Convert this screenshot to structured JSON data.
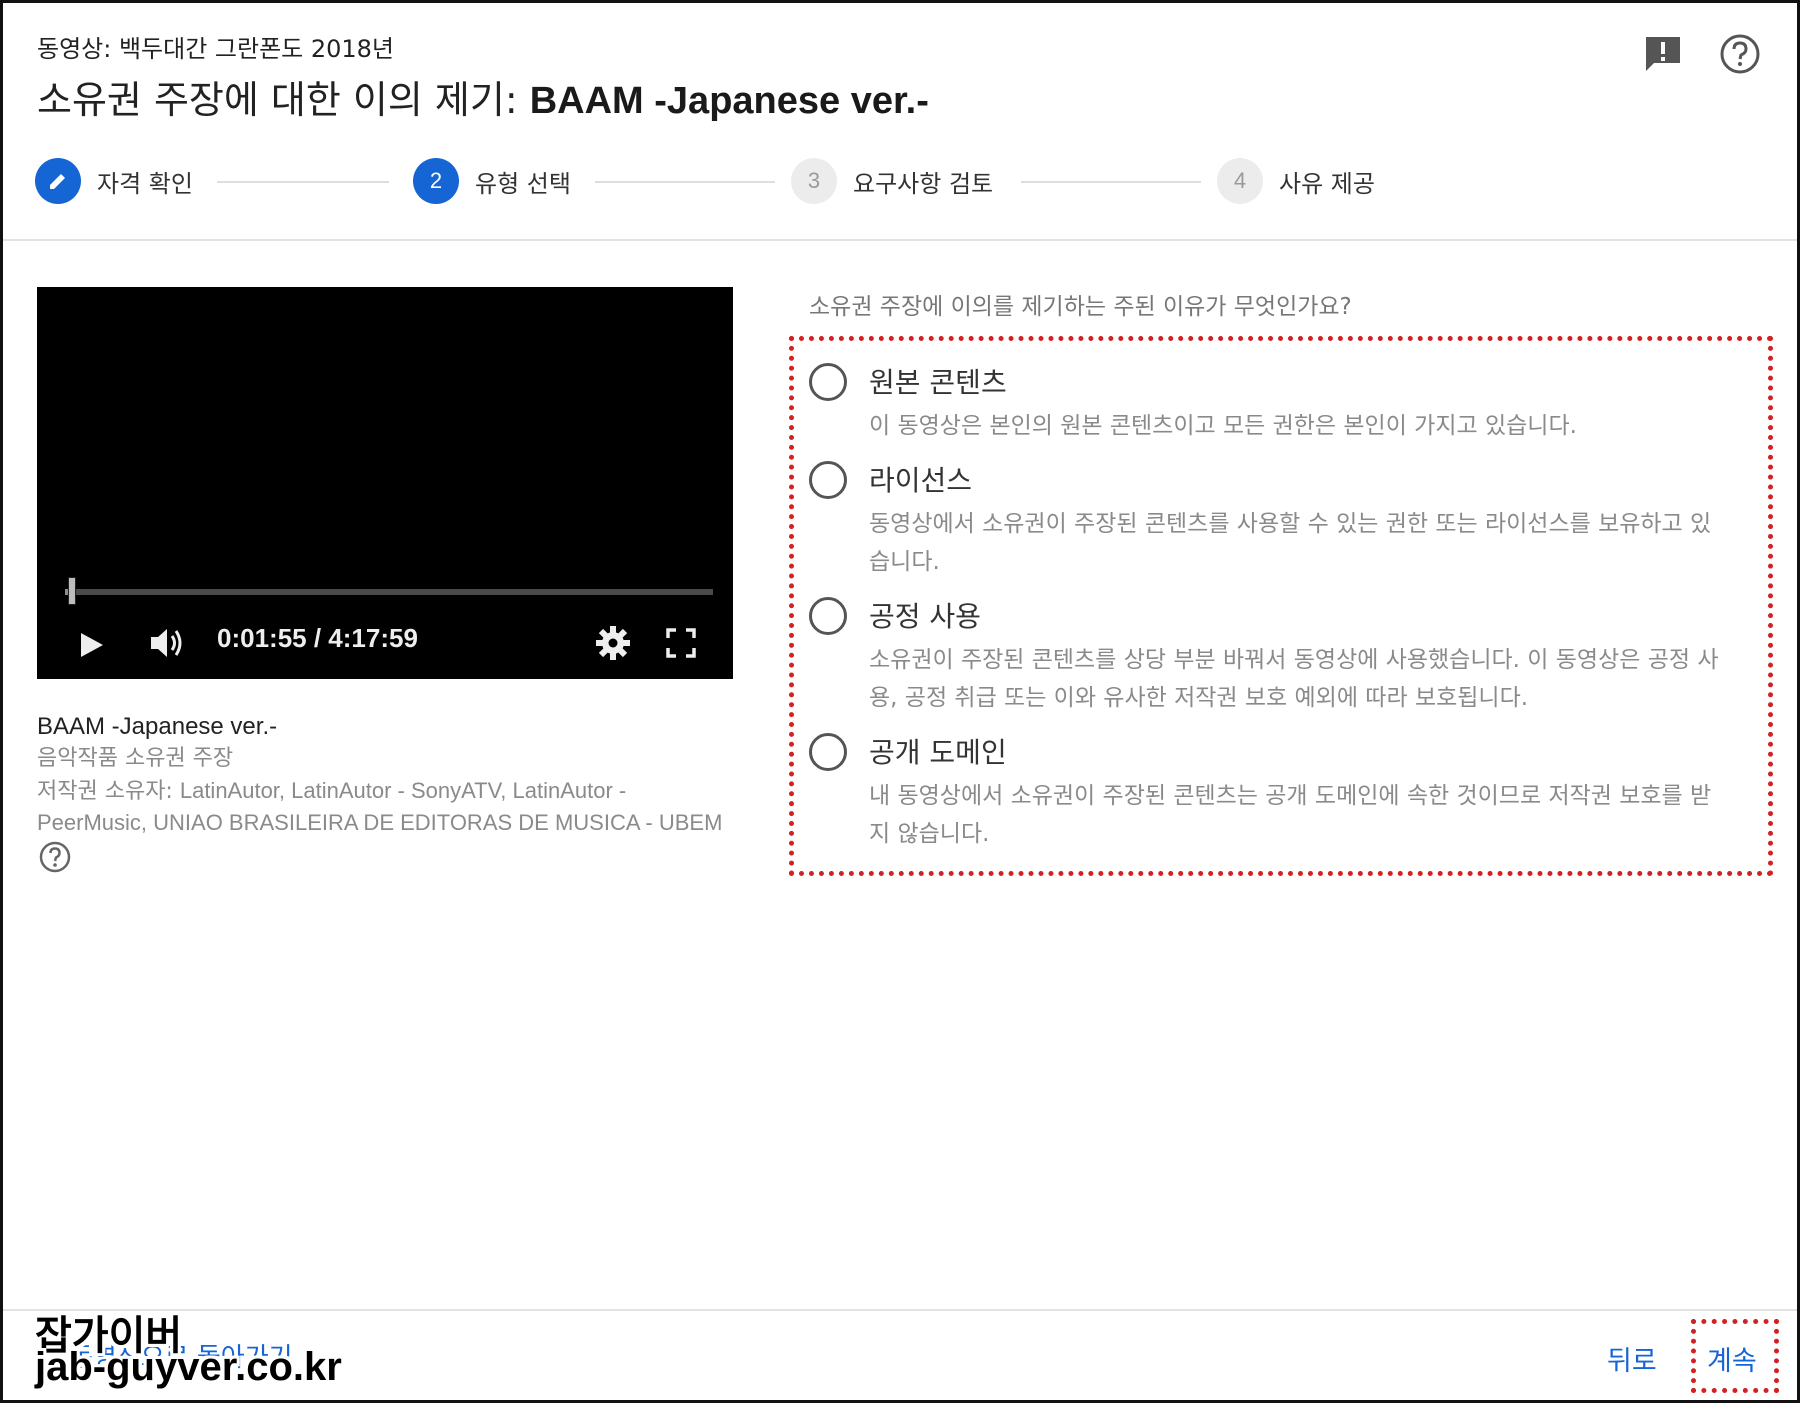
{
  "header": {
    "subtitle": "동영상: 백두대간 그란폰도 2018년",
    "title_prefix": "소유권 주장에 대한 이의 제기: ",
    "title_name": "BAAM -Japanese ver.-"
  },
  "icons": {
    "feedback": "feedback-icon",
    "help": "help-icon"
  },
  "stepper": [
    {
      "number": "✎",
      "label": "자격 확인",
      "state": "active"
    },
    {
      "number": "2",
      "label": "유형 선택",
      "state": "active"
    },
    {
      "number": "3",
      "label": "요구사항 검토",
      "state": "inactive"
    },
    {
      "number": "4",
      "label": "사유 제공",
      "state": "inactive"
    }
  ],
  "video": {
    "time": "0:01:55 / 4:17:59",
    "progress_fraction": 0.0074
  },
  "video_info": {
    "title": "BAAM -Japanese ver.-",
    "claim_type": "음악작품 소유권 주장",
    "owner_label": "저작권 소유자: ",
    "owner_names": "LatinAutor, LatinAutor - SonyATV, LatinAutor - PeerMusic, UNIAO BRASILEIRA DE EDITORAS DE MUSICA - UBEM"
  },
  "question": "소유권 주장에 이의를 제기하는 주된 이유가 무엇인가요?",
  "options": [
    {
      "label": "원본 콘텐츠",
      "desc": "이 동영상은 본인의 원본 콘텐츠이고 모든 권한은 본인이 가지고 있습니다."
    },
    {
      "label": "라이선스",
      "desc": "동영상에서 소유권이 주장된 콘텐츠를 사용할 수 있는 권한 또는 라이선스를 보유하고 있습니다."
    },
    {
      "label": "공정 사용",
      "desc": "소유권이 주장된 콘텐츠를 상당 부분 바꿔서 동영상에 사용했습니다. 이 동영상은 공정 사용, 공정 취급 또는 이와 유사한 저작권 보호 예외에 따라 보호됩니다."
    },
    {
      "label": "공개 도메인",
      "desc": "내 동영상에서 소유권이 주장된 콘텐츠는 공개 도메인에 속한 것이므로 저작권 보호를 받지 않습니다."
    }
  ],
  "footer": {
    "link": "동영상으로 돌아가기",
    "back": "뒤로",
    "continue": "계속"
  },
  "watermark": {
    "line1": "잡가이버",
    "line2": "jab-guyver.co.kr"
  },
  "colors": {
    "accent": "#1566d4",
    "highlight": "#d42020"
  }
}
